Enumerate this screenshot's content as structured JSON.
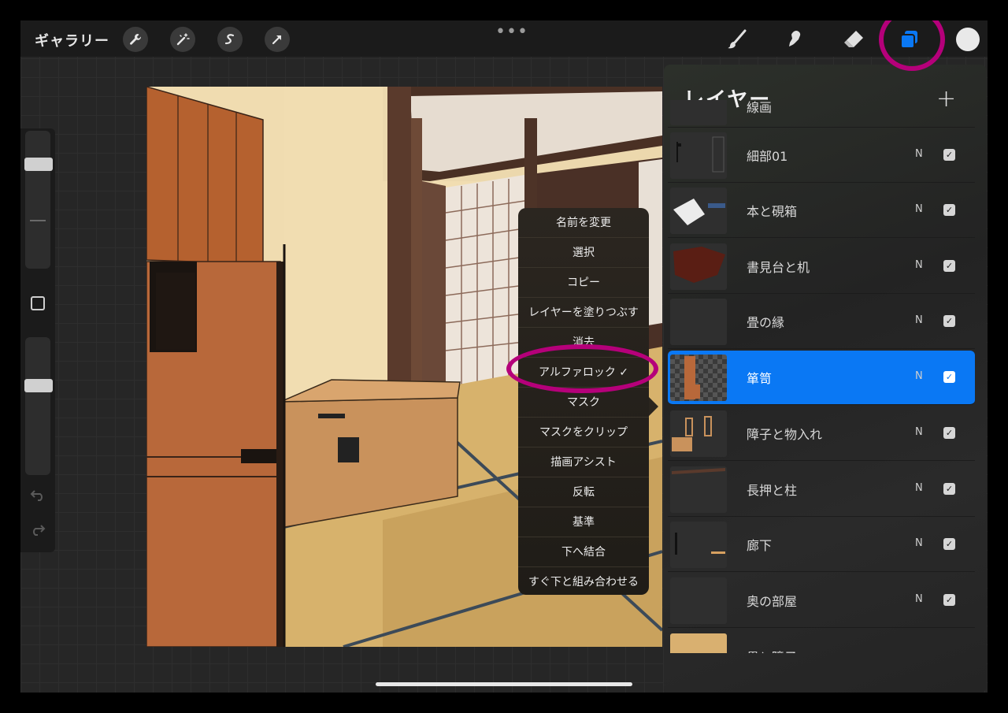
{
  "topbar": {
    "gallery_label": "ギャラリー",
    "left_tools": [
      "wrench-icon",
      "magic-wand-icon",
      "selection-icon",
      "transform-arrow-icon"
    ],
    "more_label": "•••",
    "right_tools": [
      "brush-icon",
      "smudge-icon",
      "eraser-icon",
      "layers-icon"
    ],
    "current_color": "#e9e9e9"
  },
  "sidebar": {
    "square_button": "modify-square-icon",
    "undo": "undo-icon",
    "redo": "redo-icon"
  },
  "layers_panel": {
    "title": "レイヤー",
    "add_label": "+",
    "partial_top_name": "線画",
    "partial_bottom_name": "畳と障子",
    "layers": [
      {
        "name": "細部01",
        "blend": "N",
        "checked": "✓",
        "active": false
      },
      {
        "name": "本と硯箱",
        "blend": "N",
        "checked": "✓",
        "active": false
      },
      {
        "name": "書見台と机",
        "blend": "N",
        "checked": "✓",
        "active": false
      },
      {
        "name": "畳の縁",
        "blend": "N",
        "checked": "✓",
        "active": false
      },
      {
        "name": "箪笥",
        "blend": "N",
        "checked": "✓",
        "active": true
      },
      {
        "name": "障子と物入れ",
        "blend": "N",
        "checked": "✓",
        "active": false
      },
      {
        "name": "長押と柱",
        "blend": "N",
        "checked": "✓",
        "active": false
      },
      {
        "name": "廊下",
        "blend": "N",
        "checked": "✓",
        "active": false
      },
      {
        "name": "奥の部屋",
        "blend": "N",
        "checked": "✓",
        "active": false
      }
    ]
  },
  "context_menu": {
    "items": [
      "名前を変更",
      "選択",
      "コピー",
      "レイヤーを塗りつぶす",
      "消去",
      "アルファロック ✓",
      "マスク",
      "マスクをクリップ",
      "描画アシスト",
      "反転",
      "基準",
      "下へ結合",
      "すぐ下と組み合わせる"
    ]
  },
  "colors": {
    "highlight_ring": "#b5007a",
    "active_layer": "#0a78f4"
  }
}
